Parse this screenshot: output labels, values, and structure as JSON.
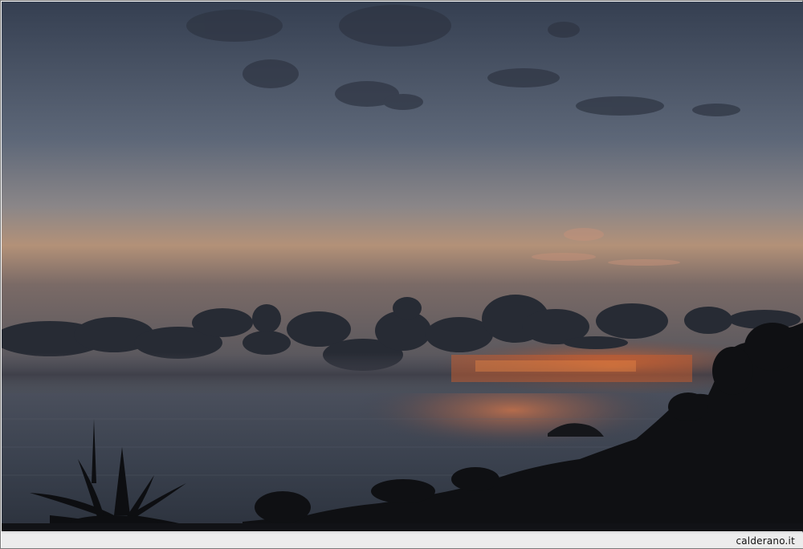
{
  "photo": {
    "subject": "sunset-over-sea",
    "colors": {
      "sky_top": "#3c4658",
      "sky_mid": "#66707f",
      "sky_low": "#b59478",
      "horizon_glow": "#d8602a",
      "cloud_dark": "#262a33",
      "sea": "#3a4250",
      "sea_reflection": "#b86a45",
      "silhouette": "#101114"
    }
  },
  "footer": {
    "credit": "calderano.it"
  }
}
